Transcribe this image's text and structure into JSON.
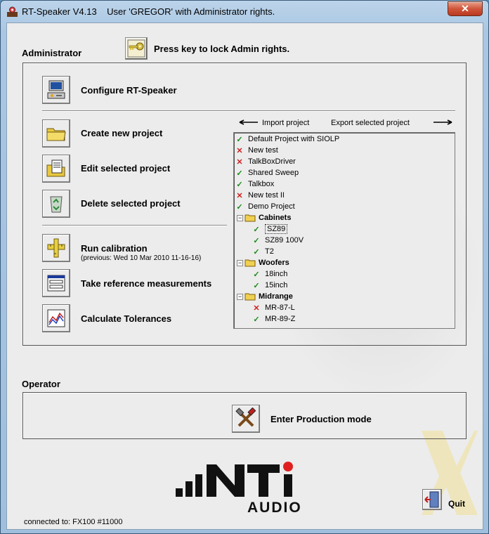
{
  "window": {
    "title": "RT-Speaker V4.13    User 'GREGOR' with Administrator rights.",
    "close_label": "✕"
  },
  "admin": {
    "section_label": "Administrator",
    "lock_text": "Press key to lock Admin rights.",
    "configure_label": "Configure RT-Speaker",
    "create_label": "Create new project",
    "edit_label": "Edit selected project",
    "delete_label": "Delete selected project",
    "calibration_label": "Run calibration",
    "calibration_previous": "(previous: Wed 10 Mar 2010 11-16-16)",
    "reference_label": "Take reference measurements",
    "tolerances_label": "Calculate Tolerances",
    "import_label": "Import project",
    "export_label": "Export selected project"
  },
  "tree": {
    "items": [
      {
        "status": "ok",
        "label": "Default Project with SIOLP"
      },
      {
        "status": "bad",
        "label": "New test"
      },
      {
        "status": "bad",
        "label": "TalkBoxDriver"
      },
      {
        "status": "ok",
        "label": "Shared Sweep"
      },
      {
        "status": "ok",
        "label": "Talkbox"
      },
      {
        "status": "bad",
        "label": "New test II"
      },
      {
        "status": "ok",
        "label": "Demo Project"
      }
    ],
    "groups": [
      {
        "label": "Cabinets",
        "items": [
          {
            "status": "ok",
            "label": "SZ89"
          },
          {
            "status": "ok",
            "label": "SZ89 100V"
          },
          {
            "status": "ok",
            "label": "T2"
          }
        ]
      },
      {
        "label": "Woofers",
        "items": [
          {
            "status": "ok",
            "label": "18inch"
          },
          {
            "status": "ok",
            "label": "15inch"
          }
        ]
      },
      {
        "label": "Midrange",
        "items": [
          {
            "status": "bad",
            "label": "MR-87-L"
          },
          {
            "status": "ok",
            "label": "MR-89-Z"
          }
        ]
      }
    ],
    "ok_mark": "✓",
    "bad_mark": "✕",
    "collapse_mark": "−"
  },
  "operator": {
    "section_label": "Operator",
    "production_label": "Enter Production mode"
  },
  "logo": {
    "brand": "NTi",
    "sub": "AUDIO"
  },
  "footer": {
    "status": "connected to: FX100 #11000",
    "quit_label": "Quit"
  }
}
